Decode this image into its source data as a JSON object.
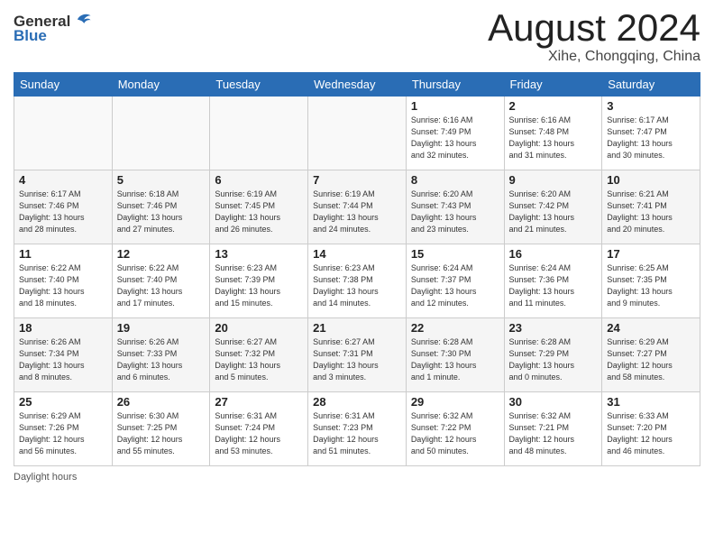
{
  "header": {
    "logo_line1": "General",
    "logo_line2": "Blue",
    "month": "August 2024",
    "location": "Xihe, Chongqing, China"
  },
  "days_of_week": [
    "Sunday",
    "Monday",
    "Tuesday",
    "Wednesday",
    "Thursday",
    "Friday",
    "Saturday"
  ],
  "weeks": [
    [
      {
        "day": "",
        "info": ""
      },
      {
        "day": "",
        "info": ""
      },
      {
        "day": "",
        "info": ""
      },
      {
        "day": "",
        "info": ""
      },
      {
        "day": "1",
        "info": "Sunrise: 6:16 AM\nSunset: 7:49 PM\nDaylight: 13 hours\nand 32 minutes."
      },
      {
        "day": "2",
        "info": "Sunrise: 6:16 AM\nSunset: 7:48 PM\nDaylight: 13 hours\nand 31 minutes."
      },
      {
        "day": "3",
        "info": "Sunrise: 6:17 AM\nSunset: 7:47 PM\nDaylight: 13 hours\nand 30 minutes."
      }
    ],
    [
      {
        "day": "4",
        "info": "Sunrise: 6:17 AM\nSunset: 7:46 PM\nDaylight: 13 hours\nand 28 minutes."
      },
      {
        "day": "5",
        "info": "Sunrise: 6:18 AM\nSunset: 7:46 PM\nDaylight: 13 hours\nand 27 minutes."
      },
      {
        "day": "6",
        "info": "Sunrise: 6:19 AM\nSunset: 7:45 PM\nDaylight: 13 hours\nand 26 minutes."
      },
      {
        "day": "7",
        "info": "Sunrise: 6:19 AM\nSunset: 7:44 PM\nDaylight: 13 hours\nand 24 minutes."
      },
      {
        "day": "8",
        "info": "Sunrise: 6:20 AM\nSunset: 7:43 PM\nDaylight: 13 hours\nand 23 minutes."
      },
      {
        "day": "9",
        "info": "Sunrise: 6:20 AM\nSunset: 7:42 PM\nDaylight: 13 hours\nand 21 minutes."
      },
      {
        "day": "10",
        "info": "Sunrise: 6:21 AM\nSunset: 7:41 PM\nDaylight: 13 hours\nand 20 minutes."
      }
    ],
    [
      {
        "day": "11",
        "info": "Sunrise: 6:22 AM\nSunset: 7:40 PM\nDaylight: 13 hours\nand 18 minutes."
      },
      {
        "day": "12",
        "info": "Sunrise: 6:22 AM\nSunset: 7:40 PM\nDaylight: 13 hours\nand 17 minutes."
      },
      {
        "day": "13",
        "info": "Sunrise: 6:23 AM\nSunset: 7:39 PM\nDaylight: 13 hours\nand 15 minutes."
      },
      {
        "day": "14",
        "info": "Sunrise: 6:23 AM\nSunset: 7:38 PM\nDaylight: 13 hours\nand 14 minutes."
      },
      {
        "day": "15",
        "info": "Sunrise: 6:24 AM\nSunset: 7:37 PM\nDaylight: 13 hours\nand 12 minutes."
      },
      {
        "day": "16",
        "info": "Sunrise: 6:24 AM\nSunset: 7:36 PM\nDaylight: 13 hours\nand 11 minutes."
      },
      {
        "day": "17",
        "info": "Sunrise: 6:25 AM\nSunset: 7:35 PM\nDaylight: 13 hours\nand 9 minutes."
      }
    ],
    [
      {
        "day": "18",
        "info": "Sunrise: 6:26 AM\nSunset: 7:34 PM\nDaylight: 13 hours\nand 8 minutes."
      },
      {
        "day": "19",
        "info": "Sunrise: 6:26 AM\nSunset: 7:33 PM\nDaylight: 13 hours\nand 6 minutes."
      },
      {
        "day": "20",
        "info": "Sunrise: 6:27 AM\nSunset: 7:32 PM\nDaylight: 13 hours\nand 5 minutes."
      },
      {
        "day": "21",
        "info": "Sunrise: 6:27 AM\nSunset: 7:31 PM\nDaylight: 13 hours\nand 3 minutes."
      },
      {
        "day": "22",
        "info": "Sunrise: 6:28 AM\nSunset: 7:30 PM\nDaylight: 13 hours\nand 1 minute."
      },
      {
        "day": "23",
        "info": "Sunrise: 6:28 AM\nSunset: 7:29 PM\nDaylight: 13 hours\nand 0 minutes."
      },
      {
        "day": "24",
        "info": "Sunrise: 6:29 AM\nSunset: 7:27 PM\nDaylight: 12 hours\nand 58 minutes."
      }
    ],
    [
      {
        "day": "25",
        "info": "Sunrise: 6:29 AM\nSunset: 7:26 PM\nDaylight: 12 hours\nand 56 minutes."
      },
      {
        "day": "26",
        "info": "Sunrise: 6:30 AM\nSunset: 7:25 PM\nDaylight: 12 hours\nand 55 minutes."
      },
      {
        "day": "27",
        "info": "Sunrise: 6:31 AM\nSunset: 7:24 PM\nDaylight: 12 hours\nand 53 minutes."
      },
      {
        "day": "28",
        "info": "Sunrise: 6:31 AM\nSunset: 7:23 PM\nDaylight: 12 hours\nand 51 minutes."
      },
      {
        "day": "29",
        "info": "Sunrise: 6:32 AM\nSunset: 7:22 PM\nDaylight: 12 hours\nand 50 minutes."
      },
      {
        "day": "30",
        "info": "Sunrise: 6:32 AM\nSunset: 7:21 PM\nDaylight: 12 hours\nand 48 minutes."
      },
      {
        "day": "31",
        "info": "Sunrise: 6:33 AM\nSunset: 7:20 PM\nDaylight: 12 hours\nand 46 minutes."
      }
    ]
  ],
  "footer": {
    "label": "Daylight hours"
  }
}
